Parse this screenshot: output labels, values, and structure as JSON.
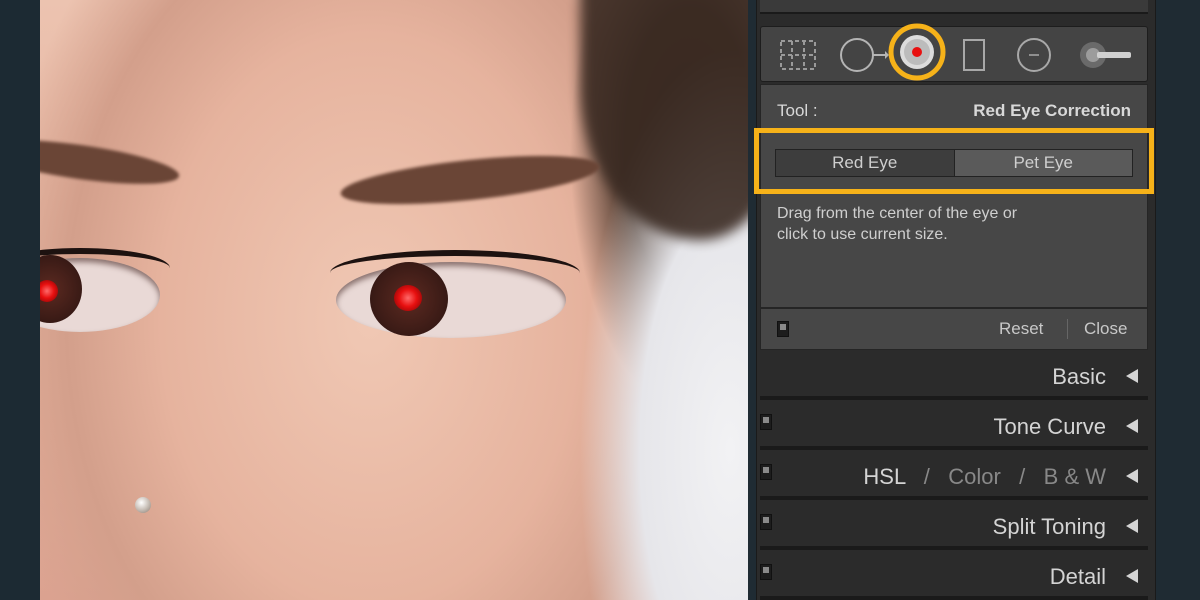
{
  "tool_panel": {
    "tool_label": "Tool :",
    "tool_name": "Red Eye Correction",
    "modes": [
      "Red Eye",
      "Pet Eye"
    ],
    "hint_line1": "Drag from the center of the eye or",
    "hint_line2": "click to use current size.",
    "reset_label": "Reset",
    "close_label": "Close"
  },
  "toolbar_icons": [
    "crop-overlay-icon",
    "spot-removal-icon",
    "red-eye-correction-icon",
    "graduated-filter-icon",
    "radial-filter-icon",
    "adjustment-brush-icon"
  ],
  "sections": {
    "basic": "Basic",
    "tone_curve": "Tone Curve",
    "hsl": "HSL",
    "hsl_sep": "/",
    "color": "Color",
    "bw": "B & W",
    "split_toning": "Split Toning",
    "detail": "Detail"
  },
  "colors": {
    "highlight": "#f6b219",
    "panel_bg": "#2b2b2b",
    "red_eye": "#e81010"
  }
}
